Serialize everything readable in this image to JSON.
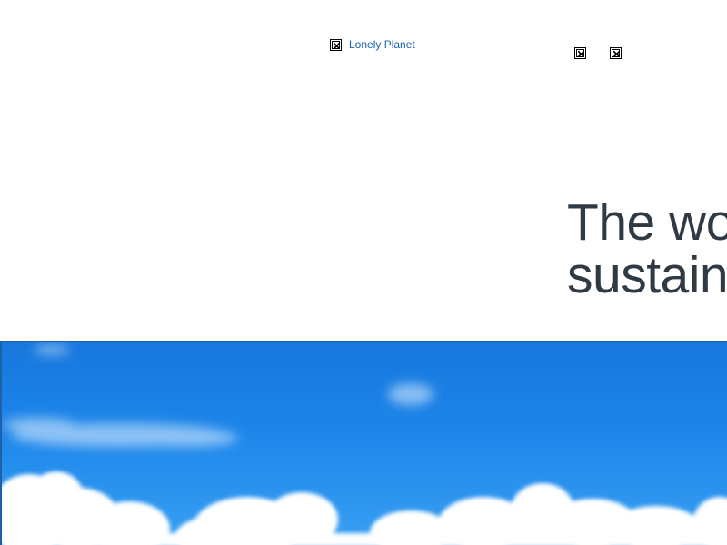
{
  "header": {
    "logo_label": "Lonely Planet",
    "logo_icon": "broken-image-icon",
    "right_icons": [
      "broken-image-icon",
      "broken-image-icon"
    ]
  },
  "hero": {
    "headline_line1": "The wo",
    "headline_line2": "sustain",
    "image": "blue-sky-clouds-image"
  },
  "colors": {
    "link": "#1a5fb4",
    "headline": "#2f3a45",
    "sky": "#1d86ea",
    "hero_border": "#1d62a8"
  }
}
